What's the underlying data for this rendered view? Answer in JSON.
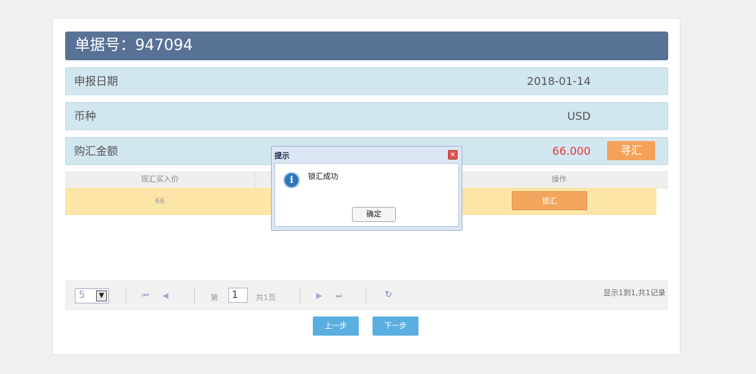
{
  "header": {
    "title": "单据号：947094"
  },
  "fields": {
    "declare_date_label": "申报日期",
    "declare_date_value": "2018-01-14",
    "currency_label": "币种",
    "currency_value": "USD",
    "purchase_amount_label": "购汇金额",
    "purchase_amount_value": "66.000",
    "xun_button": "寻汇"
  },
  "grid": {
    "columns": [
      "现汇买入价",
      "操作"
    ],
    "rows": [
      {
        "buy_price": "66",
        "action": "锁汇"
      }
    ]
  },
  "pager": {
    "page_size": "5",
    "page_prefix": "第",
    "page_number": "1",
    "page_total": "共1页",
    "record_info": "显示1到1,共1记录"
  },
  "nav": {
    "prev": "上一步",
    "next": "下一步"
  },
  "dialog": {
    "title": "提示",
    "message": "锁汇成功",
    "ok": "确定"
  },
  "colors": {
    "title_bar": "#587296",
    "info_row": "#d2e6ef",
    "amount": "#e03a3a",
    "accent_orange": "#f4a25a",
    "row_highlight": "#fbe6a8",
    "nav_button": "#5aaee0"
  },
  "icons": {
    "dialog_info": "info-icon",
    "dialog_close": "close-icon",
    "first_page": "first-page-icon",
    "prev_page": "prev-page-icon",
    "next_page": "next-page-icon",
    "last_page": "last-page-icon",
    "refresh": "refresh-icon",
    "dropdown": "chevron-down-icon"
  }
}
